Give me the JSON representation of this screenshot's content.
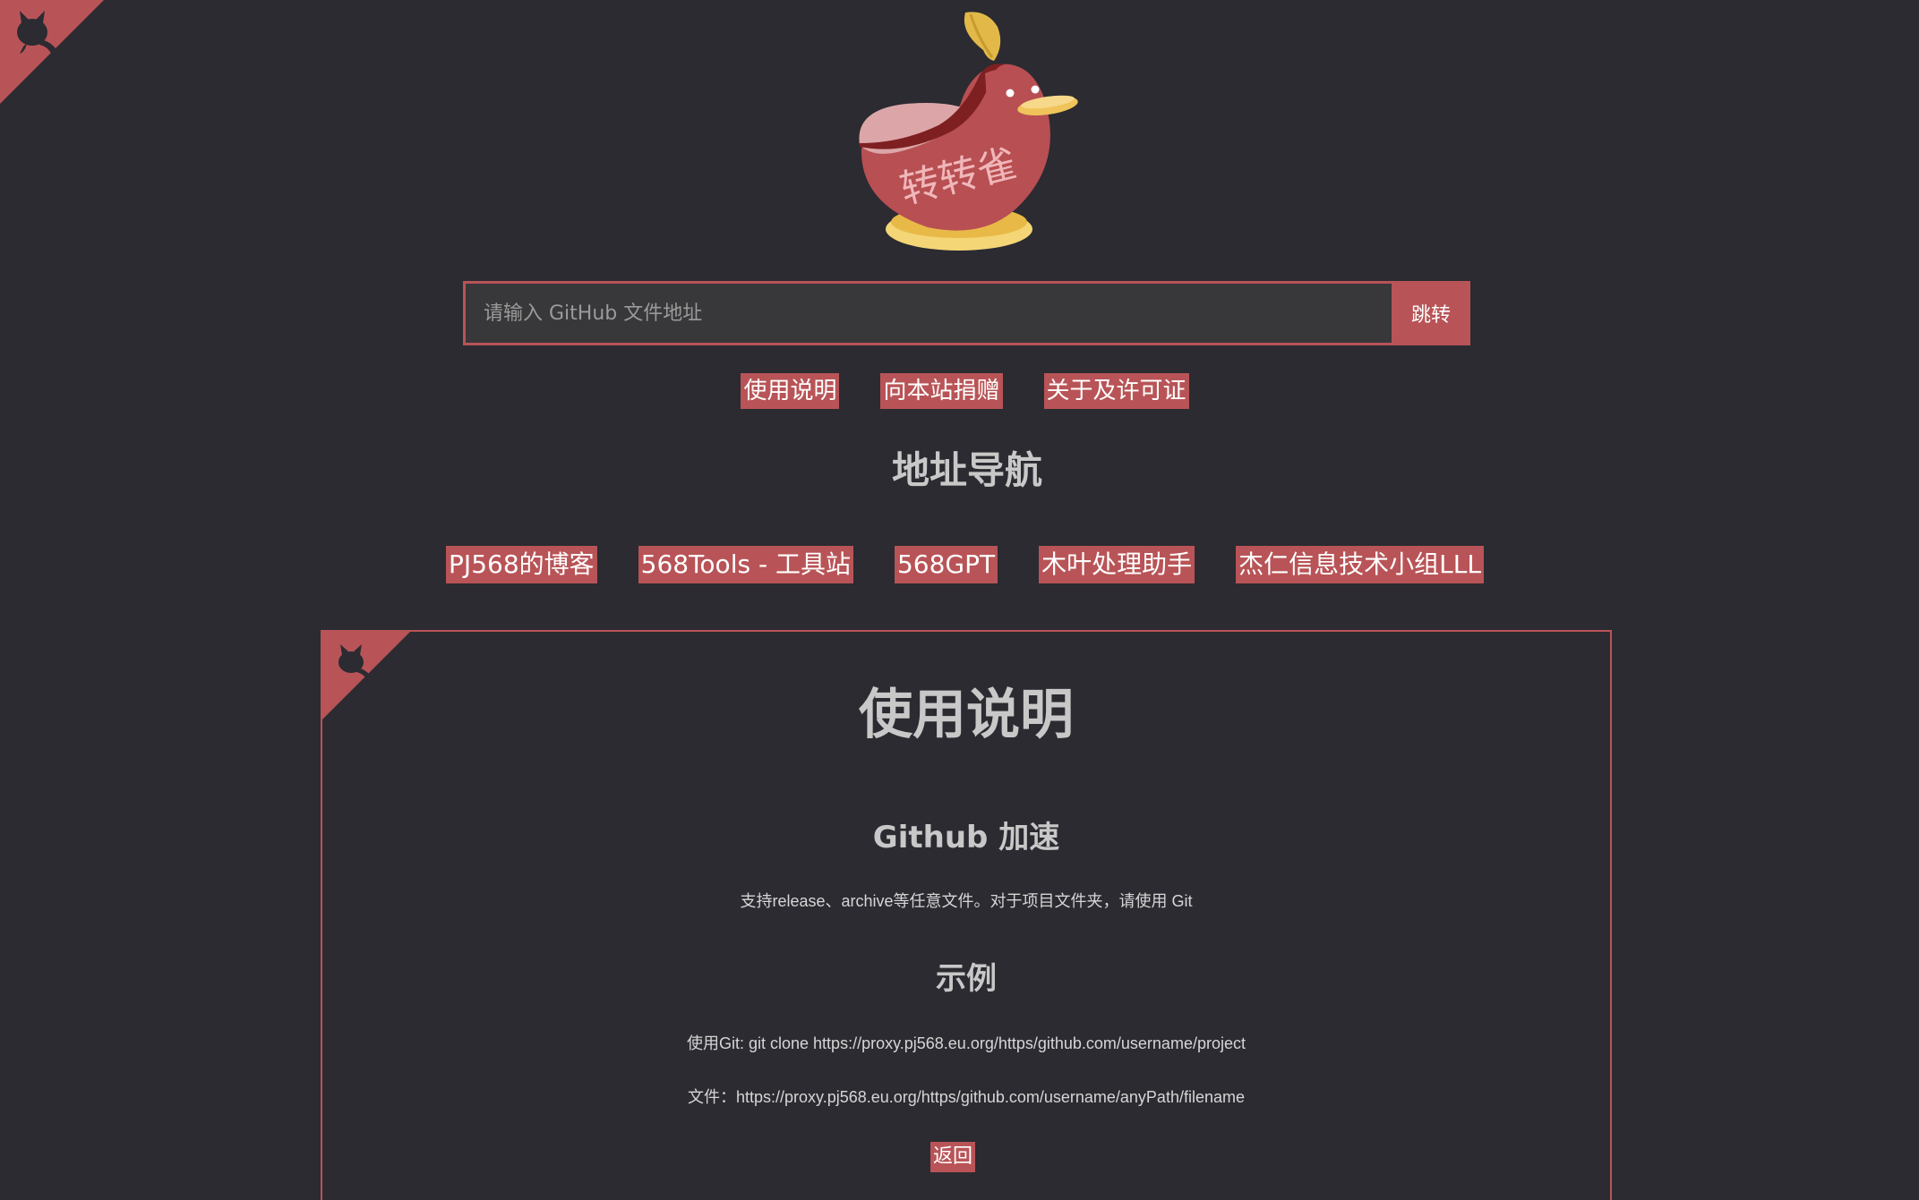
{
  "brand": {
    "logo_text": "转转雀",
    "accent_color": "#b85457",
    "background_color": "#2b2b31"
  },
  "icons": {
    "corner": "github-octocat-icon"
  },
  "search": {
    "placeholder": "请输入 GitHub 文件地址",
    "value": "",
    "button_label": "跳转"
  },
  "top_links": [
    {
      "label": "使用说明"
    },
    {
      "label": "向本站捐赠"
    },
    {
      "label": "关于及许可证"
    }
  ],
  "nav": {
    "title": "地址导航",
    "items": [
      {
        "label": "PJ568的博客"
      },
      {
        "label": "568Tools - 工具站"
      },
      {
        "label": "568GPT"
      },
      {
        "label": "木叶处理助手"
      },
      {
        "label": "杰仁信息技术小组LLL"
      }
    ]
  },
  "instructions": {
    "title": "使用说明",
    "section_title": "Github 加速",
    "section_text": "支持release、archive等任意文件。对于项目文件夹，请使用 Git",
    "example_title": "示例",
    "example_git": "使用Git: git clone https://proxy.pj568.eu.org/https/github.com/username/project",
    "example_file": "文件：https://proxy.pj568.eu.org/https/github.com/username/anyPath/filename",
    "back_label": "返回"
  }
}
